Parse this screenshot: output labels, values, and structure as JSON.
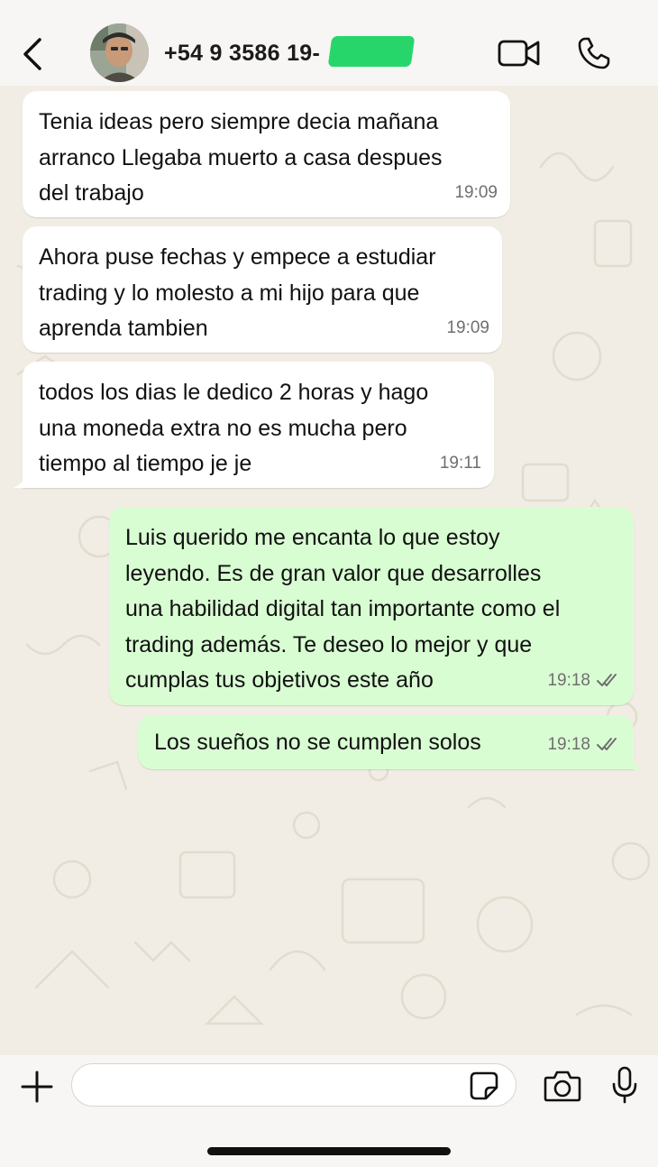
{
  "header": {
    "contact_name": "+54 9 3586 19-",
    "back_icon": "chevron-left-icon",
    "video_icon": "video-camera-icon",
    "call_icon": "phone-icon"
  },
  "messages": [
    {
      "direction": "incoming",
      "text": "Tenia ideas pero siempre decia mañana\narranco Llegaba muerto a casa despues\ndel trabajo",
      "time": "19:09"
    },
    {
      "direction": "incoming",
      "text": "Ahora puse fechas y empece a estudiar\ntrading y lo molesto a mi hijo para que\naprenda tambien",
      "time": "19:09"
    },
    {
      "direction": "incoming",
      "text": "todos los dias le dedico 2 horas y hago\nuna moneda extra no es mucha pero\ntiempo al tiempo je je",
      "time": "19:11"
    },
    {
      "direction": "outgoing",
      "text": "Luis querido me encanta lo que estoy\nleyendo. Es de gran valor que desarrolles\nuna habilidad digital tan importante como el\ntrading además. Te deseo lo mejor y que\ncumplas tus objetivos este año",
      "time": "19:18",
      "status": "read"
    },
    {
      "direction": "outgoing",
      "text": "Los sueños no se cumplen solos",
      "time": "19:18",
      "status": "read"
    }
  ],
  "composer": {
    "input_value": "",
    "plus_icon": "plus-icon",
    "sticker_icon": "sticker-icon",
    "camera_icon": "camera-icon",
    "mic_icon": "microphone-icon"
  },
  "colors": {
    "incoming_bubble": "#ffffff",
    "outgoing_bubble": "#d9fdd3",
    "chat_background": "#f1ede4",
    "redaction": "#27d66a"
  }
}
